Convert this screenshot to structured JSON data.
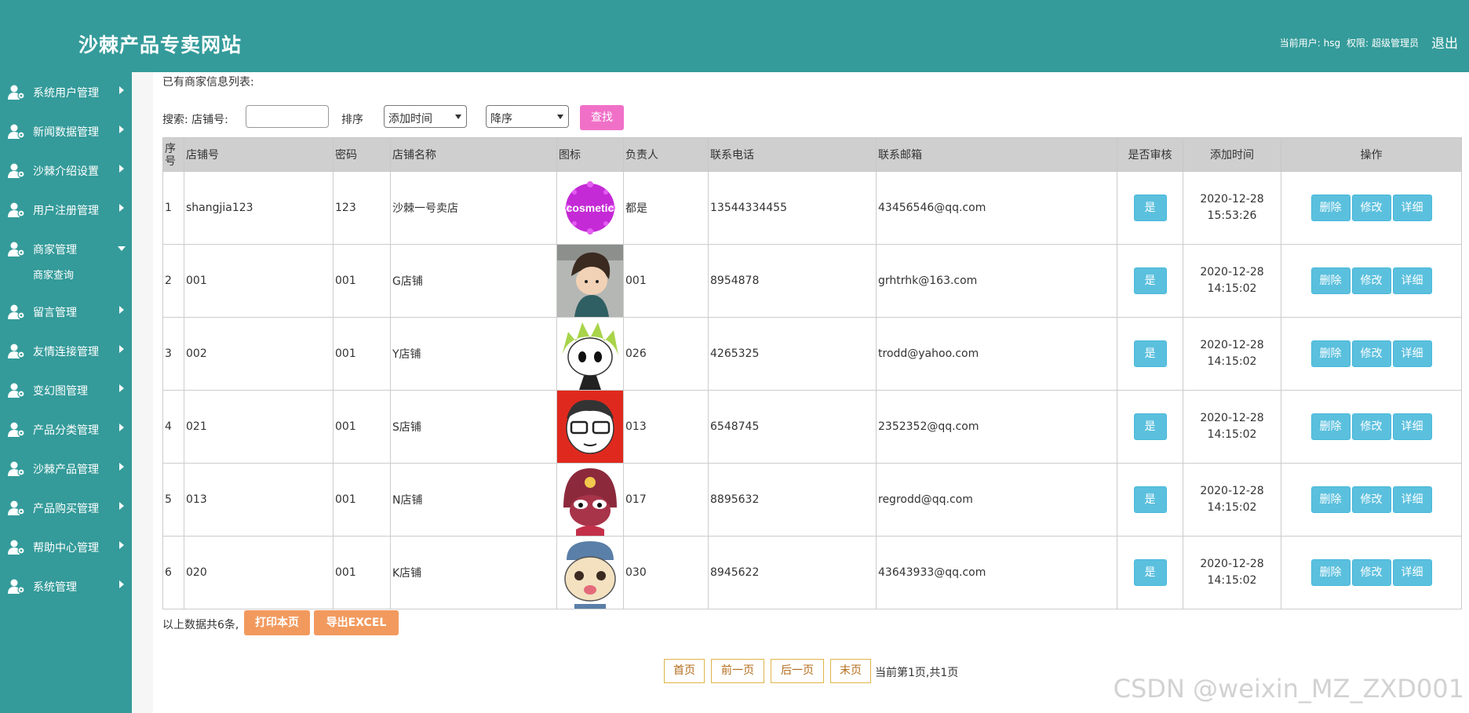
{
  "header": {
    "site_title": "沙棘产品专卖网站",
    "current_user_label": "当前用户:",
    "current_user": "hsg",
    "permission_label": "权限:",
    "permission": "超级管理员",
    "logout": "退出"
  },
  "sidebar": {
    "items": [
      {
        "label": "系统用户管理"
      },
      {
        "label": "新闻数据管理"
      },
      {
        "label": "沙棘介绍设置"
      },
      {
        "label": "用户注册管理"
      },
      {
        "label": "商家管理",
        "expanded": true,
        "sub": "商家查询"
      },
      {
        "label": "留言管理"
      },
      {
        "label": "友情连接管理"
      },
      {
        "label": "变幻图管理"
      },
      {
        "label": "产品分类管理"
      },
      {
        "label": "沙棘产品管理"
      },
      {
        "label": "产品购买管理"
      },
      {
        "label": "帮助中心管理"
      },
      {
        "label": "系统管理"
      }
    ]
  },
  "main": {
    "list_title": "已有商家信息列表:",
    "search_label": "搜索: 店铺号:",
    "search_value": "",
    "sort_label": "排序",
    "sort_field": "添加时间",
    "sort_order": "降序",
    "search_button": "查找",
    "columns": [
      "序号",
      "店铺号",
      "密码",
      "店铺名称",
      "图标",
      "负责人",
      "联系电话",
      "联系邮箱",
      "是否审核",
      "添加时间",
      "操作"
    ],
    "rows": [
      {
        "no": "1",
        "shop_id": "shangjia123",
        "password": "123",
        "shop_name": "沙棘一号卖店",
        "icon": "cosmetic-icon",
        "owner": "都是",
        "phone": "13544334455",
        "email": "43456546@qq.com",
        "audited": "是",
        "date": "2020-12-28",
        "time": "15:53:26"
      },
      {
        "no": "2",
        "shop_id": "001",
        "password": "001",
        "shop_name": "G店铺",
        "icon": "boy-avatar-icon",
        "owner": "001",
        "phone": "8954878",
        "email": "grhtrhk@163.com",
        "audited": "是",
        "date": "2020-12-28",
        "time": "14:15:02"
      },
      {
        "no": "3",
        "shop_id": "002",
        "password": "001",
        "shop_name": "Y店铺",
        "icon": "green-hair-avatar-icon",
        "owner": "026",
        "phone": "4265325",
        "email": "trodd@yahoo.com",
        "audited": "是",
        "date": "2020-12-28",
        "time": "14:15:02"
      },
      {
        "no": "4",
        "shop_id": "021",
        "password": "001",
        "shop_name": "S店铺",
        "icon": "glasses-avatar-icon",
        "owner": "013",
        "phone": "6548745",
        "email": "2352352@qq.com",
        "audited": "是",
        "date": "2020-12-28",
        "time": "14:15:02"
      },
      {
        "no": "5",
        "shop_id": "013",
        "password": "001",
        "shop_name": "N店铺",
        "icon": "keroro-avatar-icon",
        "owner": "017",
        "phone": "8895632",
        "email": "regrodd@qq.com",
        "audited": "是",
        "date": "2020-12-28",
        "time": "14:15:02"
      },
      {
        "no": "6",
        "shop_id": "020",
        "password": "001",
        "shop_name": "K店铺",
        "icon": "cat-avatar-icon",
        "owner": "030",
        "phone": "8945622",
        "email": "43643933@qq.com",
        "audited": "是",
        "date": "2020-12-28",
        "time": "14:15:02"
      }
    ],
    "actions": {
      "delete": "删除",
      "edit": "修改",
      "detail": "详细"
    },
    "count_text": "以上数据共6条,",
    "print_button": "打印本页",
    "export_button": "导出EXCEL"
  },
  "pager": {
    "first": "首页",
    "prev": "前一页",
    "next": "后一页",
    "last": "末页",
    "info": "当前第1页,共1页"
  },
  "watermark": "CSDN @weixin_MZ_ZXD001",
  "colors": {
    "theme": "#349b9a",
    "search_button": "#f070c8",
    "action_button": "#5bc0de",
    "orange_button": "#f29a5e"
  }
}
